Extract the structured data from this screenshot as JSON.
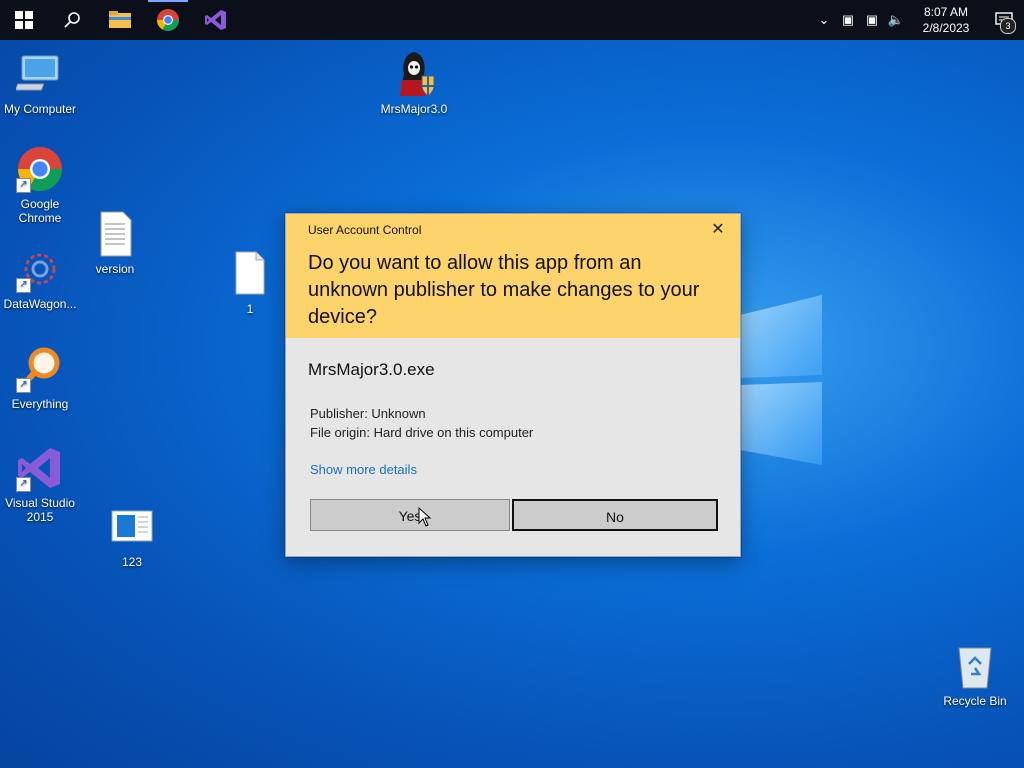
{
  "taskbar": {
    "pinned": [
      "start-icon",
      "search-icon",
      "file-explorer-icon",
      "chrome-icon",
      "visual-studio-icon"
    ],
    "clock_time": "8:07 AM",
    "clock_date": "2/8/2023",
    "notification_count": "3"
  },
  "desktop": {
    "icons": [
      {
        "label": "My Computer"
      },
      {
        "label": "Google Chrome"
      },
      {
        "label": "DataWagon..."
      },
      {
        "label": "Everything"
      },
      {
        "label": "Visual Studio 2015"
      },
      {
        "label": "version"
      },
      {
        "label": "1"
      },
      {
        "label": "123"
      },
      {
        "label": "MrsMajor3.0"
      },
      {
        "label": "Recycle Bin"
      }
    ]
  },
  "uac": {
    "title": "User Account Control",
    "question": "Do you want to allow this app from an unknown publisher to make changes to your device?",
    "app_name": "MrsMajor3.0.exe",
    "publisher": "Publisher: Unknown",
    "origin": "File origin: Hard drive on this computer",
    "more_details": "Show more details",
    "yes_label": "Yes",
    "no_label": "No",
    "header_color": "#fdd46b"
  }
}
